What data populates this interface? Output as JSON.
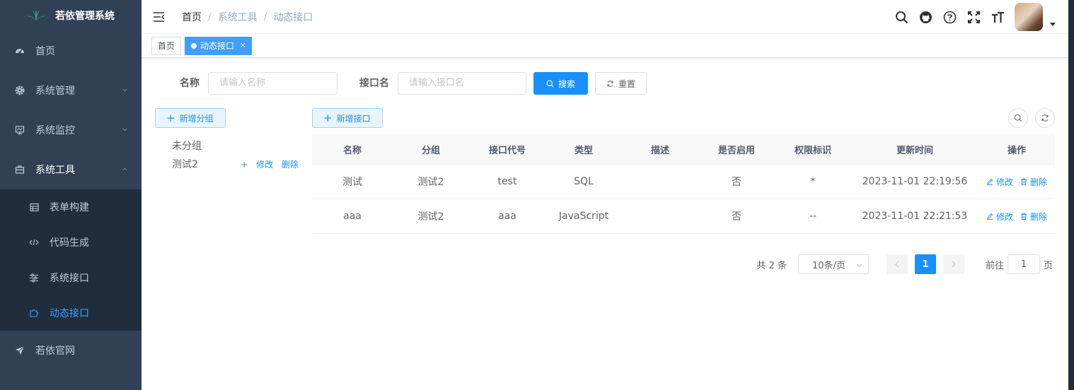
{
  "app": {
    "title": "若依管理系统"
  },
  "sidebar": {
    "items": [
      {
        "label": "首页",
        "icon": "dashboard-icon"
      },
      {
        "label": "系统管理",
        "icon": "gear-icon"
      },
      {
        "label": "系统监控",
        "icon": "monitor-icon"
      },
      {
        "label": "系统工具",
        "icon": "toolbox-icon"
      }
    ],
    "subitems": [
      {
        "label": "表单构建",
        "icon": "form-icon"
      },
      {
        "label": "代码生成",
        "icon": "code-icon"
      },
      {
        "label": "系统接口",
        "icon": "sliders-icon"
      },
      {
        "label": "动态接口",
        "icon": "plugin-icon",
        "active": true
      }
    ],
    "footer": {
      "label": "若依官网",
      "icon": "send-icon"
    }
  },
  "navbar": {
    "breadcrumb": [
      "首页",
      "系统工具",
      "动态接口"
    ],
    "separator": "/"
  },
  "tags": [
    {
      "label": "首页"
    },
    {
      "label": "动态接口",
      "active": true,
      "close": "×"
    }
  ],
  "search": {
    "name_label": "名称",
    "name_placeholder": "请输入名称",
    "api_label": "接口名",
    "api_placeholder": "请输入接口名",
    "search_btn": "搜索",
    "reset_btn": "重置"
  },
  "groups": {
    "add_btn": "新增分组",
    "nodes": [
      {
        "label": "未分组"
      },
      {
        "label": "测试2",
        "ops": [
          "+",
          "修改",
          "删除"
        ]
      }
    ]
  },
  "table": {
    "add_btn": "新增接口",
    "columns": [
      "名称",
      "分组",
      "接口代号",
      "类型",
      "描述",
      "是否启用",
      "权限标识",
      "更新时间",
      "操作"
    ],
    "rows": [
      [
        "测试",
        "测试2",
        "test",
        "SQL",
        "",
        "否",
        "*",
        "2023-11-01 22:19:56"
      ],
      [
        "aaa",
        "测试2",
        "aaa",
        "JavaScript",
        "",
        "否",
        "--",
        "2023-11-01 22:21:53"
      ]
    ],
    "row_ops": {
      "edit": "修改",
      "delete": "删除"
    }
  },
  "pagination": {
    "total": "共 2 条",
    "page_size": "10条/页",
    "current_page": "1",
    "goto_label": "前往",
    "goto_value": "1",
    "page_suffix": "页"
  },
  "colors": {
    "primary": "#1890ff",
    "sidebar": "#304156",
    "submenu": "#1f2d3d"
  }
}
